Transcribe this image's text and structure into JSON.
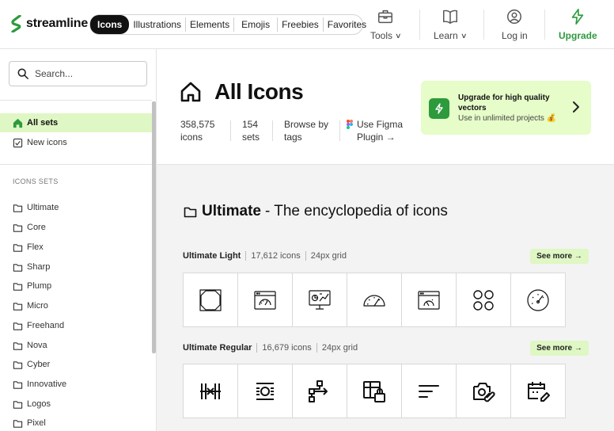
{
  "header": {
    "logo_text": "streamline",
    "pill_nav": [
      "Icons",
      "Illustrations",
      "Elements",
      "Emojis",
      "Freebies",
      "Favorites"
    ],
    "tools_label": "Tools",
    "learn_label": "Learn",
    "login_label": "Log in",
    "upgrade_label": "Upgrade"
  },
  "sidebar": {
    "search_placeholder": "Search...",
    "all_sets": "All sets",
    "new_icons": "New icons",
    "heading": "ICONS SETS",
    "sets": [
      "Ultimate",
      "Core",
      "Flex",
      "Sharp",
      "Plump",
      "Micro",
      "Freehand",
      "Nova",
      "Cyber",
      "Innovative",
      "Logos",
      "Pixel"
    ]
  },
  "hero": {
    "title": "All Icons",
    "stat_icons_value": "358,575",
    "stat_icons_label": "icons",
    "stat_sets_value": "154",
    "stat_sets_label": "sets",
    "browse_line1": "Browse by",
    "browse_line2": "tags",
    "figma_line1": "Use Figma",
    "figma_line2": "Plugin →"
  },
  "promo": {
    "title": "Upgrade for high quality vectors",
    "subtitle": "Use in unlimited projects 💰"
  },
  "section": {
    "title_bold": "Ultimate",
    "title_rest": "- The encyclopedia of icons"
  },
  "rows": [
    {
      "name": "Ultimate Light",
      "count": "17,612 icons",
      "grid": "24px grid",
      "see_more": "See more →"
    },
    {
      "name": "Ultimate Regular",
      "count": "16,679 icons",
      "grid": "24px grid",
      "see_more": "See more →"
    }
  ],
  "colors": {
    "accent_green": "#2d9a3c",
    "light_green": "#dff7c4",
    "promo_bg": "#e6fcc9"
  }
}
